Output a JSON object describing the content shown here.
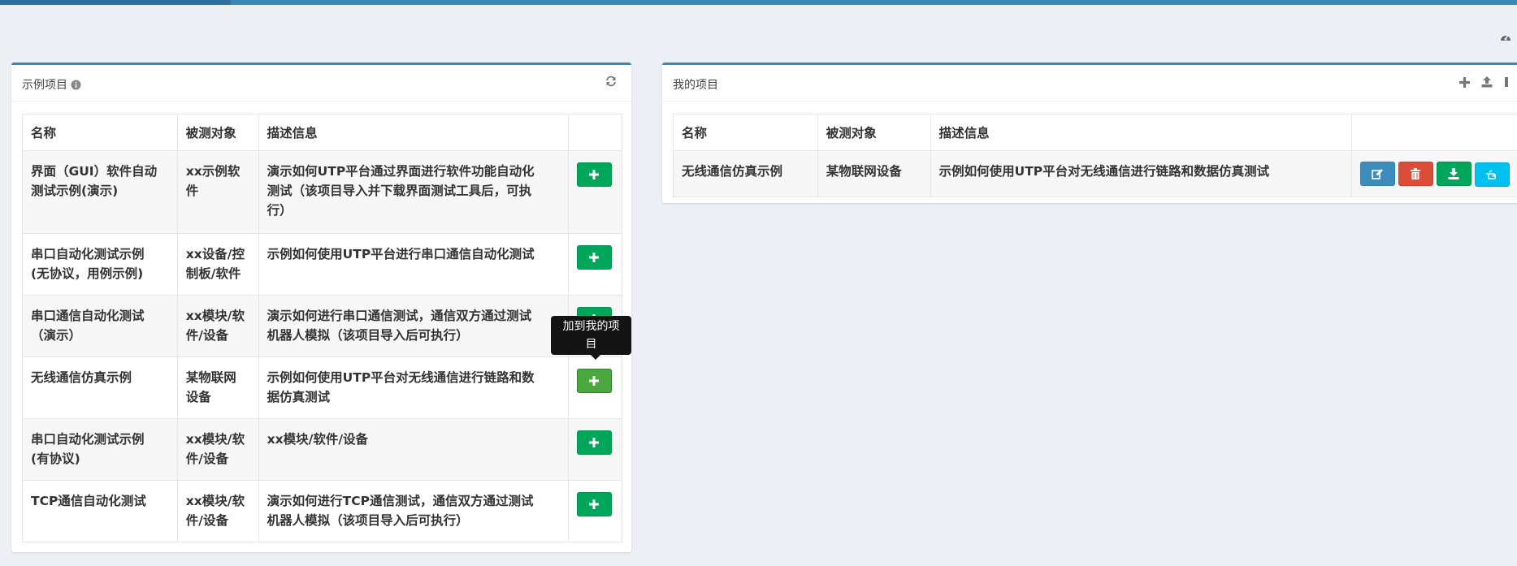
{
  "icons": {
    "dashboard": "tachometer-icon",
    "info": "info-circle-icon",
    "refresh": "refresh-icon",
    "plus": "plus-icon",
    "upload": "upload-icon",
    "edit": "edit-icon",
    "delete": "trash-icon",
    "download": "download-icon",
    "use": "hand-pointer-icon"
  },
  "colors": {
    "accent": "#3a87b8",
    "success": "#00a65a",
    "danger": "#dd4b39",
    "info": "#00c0ef",
    "primary": "#3c8dbc"
  },
  "left_panel": {
    "title": "示例项目",
    "columns": [
      "名称",
      "被测对象",
      "描述信息",
      ""
    ],
    "rows": [
      {
        "name": [
          "界面（GUI）软件自动",
          "测试示例(演示)"
        ],
        "target": [
          "xx示例软",
          "件"
        ],
        "desc": [
          "演示如何UTP平台通过界面进行软件功能自动化",
          "测试（该项目导入并下载界面测试工具后，可执",
          "行）"
        ]
      },
      {
        "name": [
          "串口自动化测试示例",
          "(无协议，用例示例)"
        ],
        "target": [
          "xx设备/控",
          "制板/软件"
        ],
        "desc": [
          "示例如何使用UTP平台进行串口通信自动化测试"
        ]
      },
      {
        "name": [
          "串口通信自动化测试",
          "（演示）"
        ],
        "target": [
          "xx模块/软",
          "件/设备"
        ],
        "desc": [
          "演示如何进行串口通信测试，通信双方通过测试",
          "机器人模拟（该项目导入后可执行）"
        ]
      },
      {
        "name": [
          "无线通信仿真示例"
        ],
        "target": [
          "某物联网",
          "设备"
        ],
        "desc": [
          "示例如何使用UTP平台对无线通信进行链路和数",
          "据仿真测试"
        ]
      },
      {
        "name": [
          "串口自动化测试示例",
          "(有协议)"
        ],
        "target": [
          "xx模块/软",
          "件/设备"
        ],
        "desc": [
          "xx模块/软件/设备"
        ]
      },
      {
        "name": [
          "TCP通信自动化测试"
        ],
        "target": [
          "xx模块/软",
          "件/设备"
        ],
        "desc": [
          "演示如何进行TCP通信测试，通信双方通过测试",
          "机器人模拟（该项目导入后可执行）"
        ]
      }
    ],
    "tooltip": [
      "加到我的项",
      "目"
    ]
  },
  "right_panel": {
    "title": "我的项目",
    "columns": [
      "名称",
      "被测对象",
      "描述信息",
      ""
    ],
    "rows": [
      {
        "name": "无线通信仿真示例",
        "target": "某物联网设备",
        "desc": "示例如何使用UTP平台对无线通信进行链路和数据仿真测试"
      }
    ]
  }
}
